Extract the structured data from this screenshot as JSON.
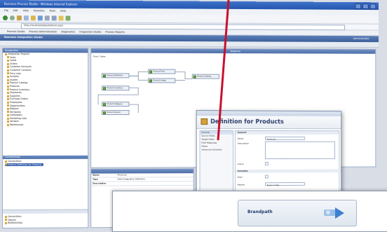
{
  "window": {
    "title": "Business Process Studio - Windows Internet Explorer"
  },
  "menu": [
    "File",
    "Edit",
    "View",
    "Favorites",
    "Tools",
    "Help"
  ],
  "address": {
    "url": "http://localhost/bps/default.aspx"
  },
  "favorites": [
    "Process Studio",
    "Process Administration",
    "Diagnostics",
    "Integration Studio",
    "Process Reports"
  ],
  "app_header": {
    "title": "Business Integration Studio",
    "user": "Administrator"
  },
  "tree": {
    "header": "Integration",
    "items": [
      "Integration Projects",
      "Sales",
      "Leads",
      "Orders",
      "Customer Accounts",
      "Customer Contacts",
      "Price Lists",
      "Invoices",
      "Quotes",
      "Product Catalog",
      "Products",
      "Product Inventory",
      "Shipments",
      "Suppliers",
      "Purchase Orders",
      "Employees",
      "Opportunities",
      "Regions",
      "Territories",
      "Campaigns",
      "Marketing Lists",
      "Vendors",
      "Warehouses"
    ],
    "section_header": "Connections",
    "section_items": [
      "Connections",
      "Product Definition for Products"
    ],
    "bottom_items": [
      "Connections",
      "Objects",
      "Relationships"
    ]
  },
  "diagram": {
    "header": "Diagram",
    "breadcrumb": "Root / Sales",
    "nodes": [
      "Product Definition",
      "Product Price",
      "Product Catalog",
      "Product Image",
      "Product Inventory",
      "Product Category",
      "Product Vendor"
    ]
  },
  "properties": {
    "rows": [
      {
        "key": "Name",
        "value": "Products"
      },
      {
        "key": "Type",
        "value": "Data Integration Definition"
      },
      {
        "key": "Description",
        "value": ""
      }
    ]
  },
  "dialog": {
    "title": "Definition for Products",
    "nav_items": [
      "General",
      "Source Fields",
      "Target Fields",
      "Field Mappings",
      "Filters",
      "Advanced Schedule"
    ],
    "section_general": "General",
    "section_schedule": "Schedule",
    "field_name_label": "Name",
    "field_name_value": "Products",
    "field_desc_label": "Description",
    "field_active_label": "Active",
    "field_start_label": "Start",
    "field_repeat_label": "Repeat",
    "field_repeat_value": "Every 1 Day"
  },
  "wizard": {
    "banner_title": "Brandpath"
  },
  "colors": {
    "accent": "#2456b0",
    "pointer": "#c8102e"
  }
}
